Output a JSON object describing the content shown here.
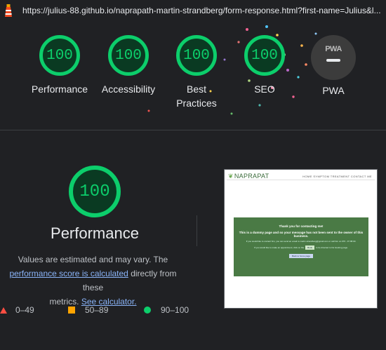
{
  "browser": {
    "url": "https://julius-88.github.io/naprapath-martin-strandberg/form-response.html?first-name=Julius&l..."
  },
  "categories": [
    {
      "label": "Performance",
      "score": "100"
    },
    {
      "label": "Accessibility",
      "score": "100"
    },
    {
      "label": "Best Practices",
      "score": "100"
    },
    {
      "label": "SEO",
      "score": "100"
    },
    {
      "label": "PWA",
      "badge": "PWA"
    }
  ],
  "performance": {
    "score": "100",
    "title": "Performance",
    "desc_1": "Values are estimated and may vary. The",
    "score_link": "performance score is calculated",
    "desc_2": " directly from these",
    "desc_3": "metrics. ",
    "calc_link": "See calculator."
  },
  "legend": {
    "fail": "0–49",
    "average": "50–89",
    "pass": "90–100"
  },
  "colors": {
    "pass": "#0cce6b",
    "average": "#ffa400",
    "fail": "#ff4e42",
    "link": "#8ab4f8",
    "background": "#202124"
  },
  "screenshot": {
    "logo": "NAPRAPAT",
    "nav": "HOME   SYMPTOM   TREATMENT   CONTACT ME",
    "heading": "Thank you for contacting me!",
    "subheading": "This is a dummy page and so your message has not been sent to the owner of this business.",
    "text": "If you would like to contact him, you can send an email to martin.strandberg@gmail.com or call him on 070 - 97 88 00.",
    "row_text_1": "If you would like to make an appointment, click on the",
    "button": "Book",
    "row_text_2": "to be directed to his booking page.",
    "link_button": "Back to home page"
  }
}
